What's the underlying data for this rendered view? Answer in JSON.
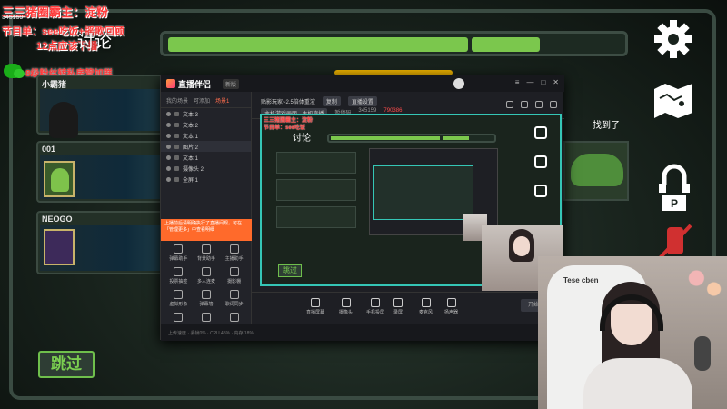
{
  "overlay": {
    "line1": "三三猪圈霸主：淀粉",
    "line1_sub": "345159",
    "line2": "节目单：see吃饭+摇歌回顾",
    "line3": "12点应该下播",
    "wechat_text": "8级粉丝转私房管加群"
  },
  "game": {
    "discuss_label": "讨论",
    "progress_fraction": 0.82,
    "found_label": "找到了",
    "skip_label": "跳过",
    "players": [
      {
        "name": "小霸猪"
      },
      {
        "name": "001"
      },
      {
        "name": "NEOGO"
      }
    ],
    "icons": [
      "gear-icon",
      "map-icon",
      "lock-icon",
      "mute-icon"
    ]
  },
  "app": {
    "title": "直播伴侣",
    "badge": "新版",
    "sidebar_tabs": [
      "我的场景",
      "可添加",
      "场景1"
    ],
    "sources": [
      "文本 3",
      "文本 2",
      "文本 1",
      "图片 2",
      "文本 1",
      "摄像头 2",
      "全屏 1"
    ],
    "notice": "上播前后请明确执行了直播间规，可在「管理更多」中查看明细",
    "tools": [
      "弹幕助手",
      "背景助手",
      "主播助手",
      "投票抽签",
      "多人连麦",
      "摄影棚",
      "虚拟形象",
      "弹幕墙",
      "歌词同步",
      "",
      "",
      ""
    ],
    "toolbar": {
      "title": "贴影玩家~2.5倍体重渲",
      "btn1": "复制",
      "btn2": "直播设置",
      "scene_btn": "主机游戏画面 · 主机直播",
      "code_label": "暂停码",
      "code_value": "345159",
      "views": "790386"
    },
    "bottom": [
      "直播屏幕",
      "摄像头",
      "手机投屏",
      "录屏",
      "麦克风",
      "扬声器"
    ],
    "live_button": "开始直播",
    "status": "上传速度 · 丢帧0% · CPU 45% · 内存 18%"
  },
  "preview": {
    "overlay": "三三猪圈霸主：淀粉\n节目单：see吃饭",
    "discuss_label": "讨论",
    "skip_label": "跳过"
  },
  "webcam": {
    "chair_text": "Tese cben"
  }
}
